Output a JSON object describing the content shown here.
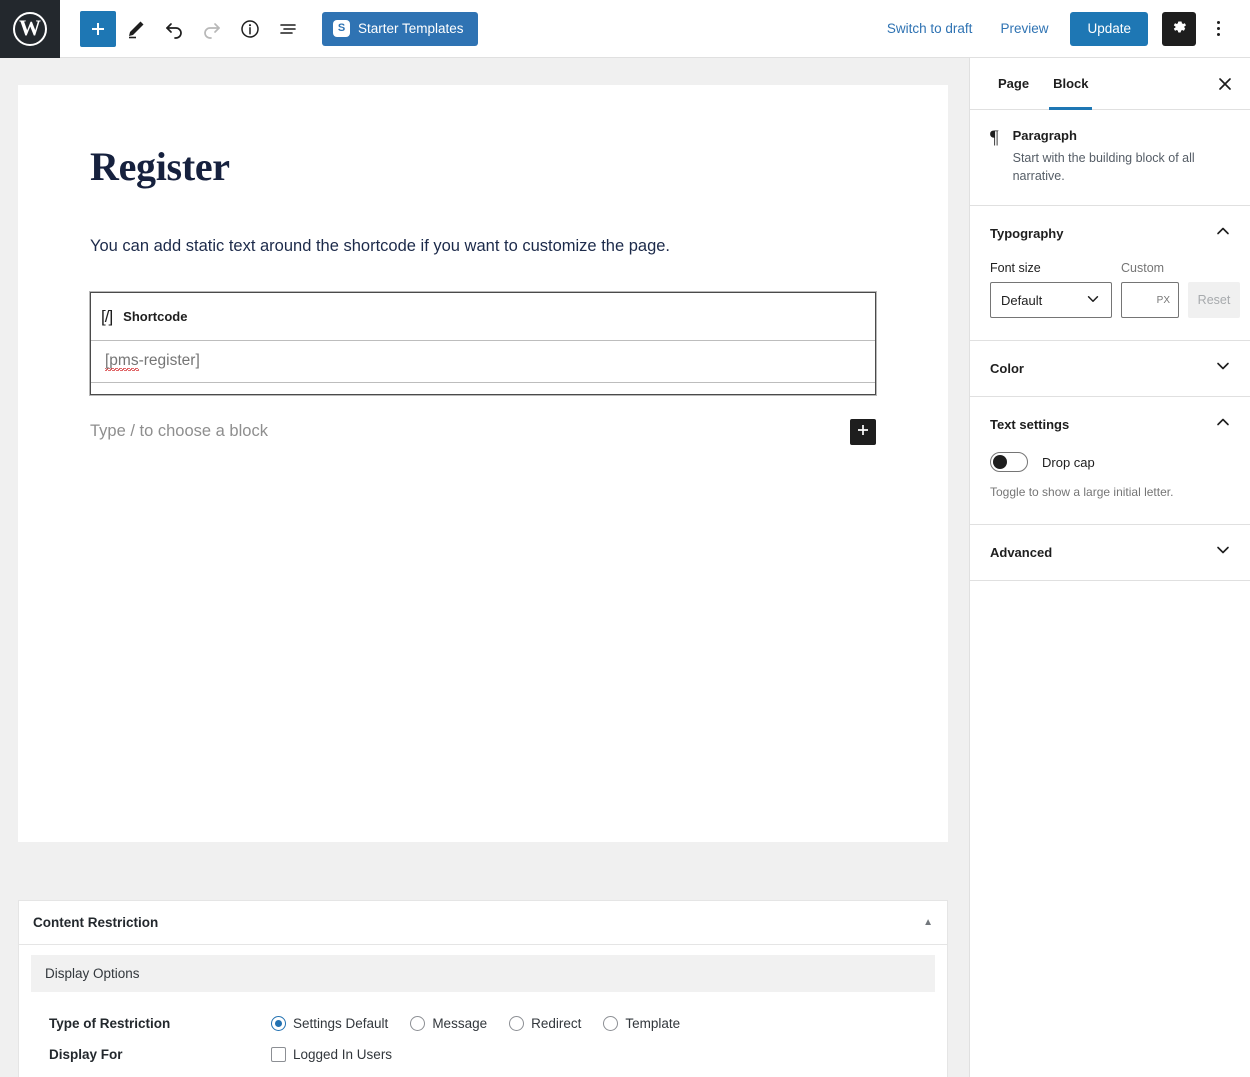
{
  "topbar": {
    "logo_icon": "wordpress-logo",
    "logo_letter": "W",
    "tools": [
      {
        "name": "add-block-button",
        "icon": "plus-icon"
      },
      {
        "name": "edit-tools-button",
        "icon": "pencil-icon"
      },
      {
        "name": "undo-button",
        "icon": "undo-arrow-icon"
      },
      {
        "name": "redo-button",
        "icon": "redo-arrow-icon"
      },
      {
        "name": "details-button",
        "icon": "info-circle-icon"
      },
      {
        "name": "list-view-button",
        "icon": "list-view-icon"
      }
    ],
    "starter_templates": {
      "label": "Starter Templates",
      "badge": "S"
    },
    "switch_to_draft": "Switch to draft",
    "preview": "Preview",
    "update": "Update",
    "settings_icon": "gear-icon",
    "more_options_icon": "kebab-menu-icon"
  },
  "editor": {
    "post_title": "Register",
    "paragraph": "You can add static text around the shortcode if you want to customize the page.",
    "shortcode_block": {
      "icon": "[/]",
      "label": "Shortcode",
      "value_prefix": "[pms",
      "value_suffix": "-register]",
      "value_full": "[pms-register]"
    },
    "placeholder": "Type / to choose a block",
    "inline_adder_icon": "plus-icon"
  },
  "metabox": {
    "title": "Content Restriction",
    "toggle_icon": "triangle-up-icon",
    "section_label": "Display Options",
    "rows": [
      {
        "label": "Type of Restriction",
        "type": "radio",
        "options": [
          {
            "label": "Settings Default",
            "checked": true
          },
          {
            "label": "Message",
            "checked": false
          },
          {
            "label": "Redirect",
            "checked": false
          },
          {
            "label": "Template",
            "checked": false
          }
        ]
      },
      {
        "label": "Display For",
        "type": "checkbox",
        "options": [
          {
            "label": "Logged In Users",
            "checked": false
          }
        ]
      }
    ]
  },
  "sidebar": {
    "tabs": [
      {
        "label": "Page",
        "active": false
      },
      {
        "label": "Block",
        "active": true
      }
    ],
    "close_icon": "close-icon",
    "block_card": {
      "icon": "paragraph-pilcrow-icon",
      "icon_glyph": "¶",
      "name": "Paragraph",
      "description": "Start with the building block of all narrative."
    },
    "panels": [
      {
        "title": "Typography",
        "expanded": true,
        "chevron": "chevron-up-icon",
        "font_size_label": "Font size",
        "custom_label": "Custom",
        "font_size_value": "Default",
        "custom_value": "",
        "custom_unit": "PX",
        "reset_label": "Reset"
      },
      {
        "title": "Color",
        "expanded": false,
        "chevron": "chevron-down-icon"
      },
      {
        "title": "Text settings",
        "expanded": true,
        "chevron": "chevron-up-icon",
        "toggle_label": "Drop cap",
        "toggle_on": false,
        "help_text": "Toggle to show a large initial letter."
      },
      {
        "title": "Advanced",
        "expanded": false,
        "chevron": "chevron-down-icon"
      }
    ]
  },
  "colors": {
    "accent_blue": "#1e77b4",
    "link_blue": "#2f73b3",
    "dark": "#1e1e1e",
    "admin_bar": "#23282d",
    "title_navy": "#16213e",
    "radio_blue": "#2271b1"
  }
}
